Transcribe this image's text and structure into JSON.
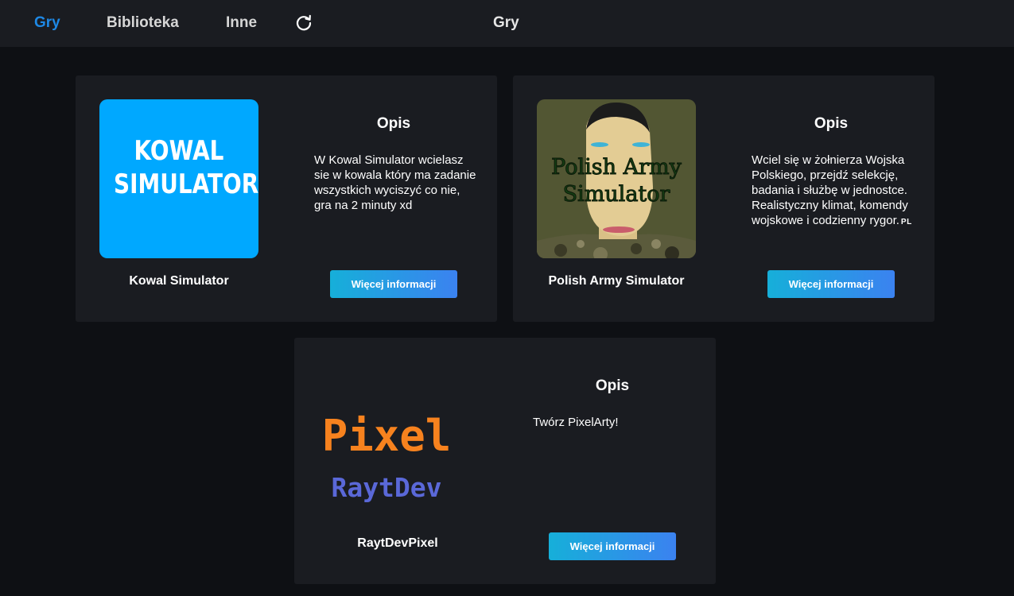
{
  "nav": {
    "items": [
      {
        "label": "Gry",
        "active": true
      },
      {
        "label": "Biblioteka",
        "active": false
      },
      {
        "label": "Inne",
        "active": false
      }
    ],
    "refresh_icon": "refresh-icon",
    "page_title": "Gry"
  },
  "games": [
    {
      "name": "Kowal Simulator",
      "thumb_text": [
        "KOWAL",
        "SIMULATOR"
      ],
      "desc_title": "Opis",
      "desc": "W Kowal Simulator wcielasz sie w kowala który ma zadanie wszystkich wyciszyć co nie, gra na 2 minuty xd",
      "button": "Więcej informacji"
    },
    {
      "name": "Polish Army Simulator",
      "thumb_text": [
        "Polish Army",
        "Simulator"
      ],
      "desc_title": "Opis",
      "desc": "Wciel się w żołnierza Wojska Polskiego, przejdź selekcję, badania i służbę w jednostce. Realistyczny klimat, komendy wojskowe i codzienny rygor.",
      "desc_badge": "PL",
      "button": "Więcej informacji"
    },
    {
      "name": "RaytDevPixel",
      "thumb_text": [
        "Pixel",
        "RaytDev"
      ],
      "desc_title": "Opis",
      "desc": "Twórz PixelArty!",
      "button": "Więcej informacji"
    }
  ],
  "colors": {
    "background": "#0e1014",
    "topbar": "#1a1c21",
    "card": "#1a1c21",
    "nav_active": "#1e88e5",
    "button_gradient_start": "#16afd9",
    "button_gradient_end": "#3b82f0",
    "kowal_thumb": "#00a8ff",
    "pixel_orange": "#f7821e",
    "raytdev_blue": "#5a68d8"
  }
}
